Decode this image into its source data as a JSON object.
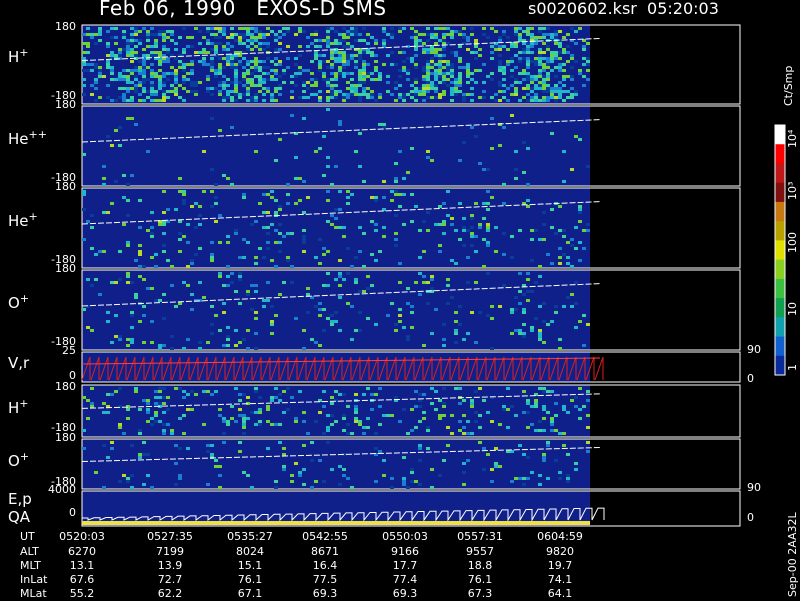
{
  "header": {
    "title": "Feb 06, 1990   EXOS-D SMS",
    "file": "s0020602.ksr  05:20:03"
  },
  "colors": {
    "background": "#000000",
    "panel_bg": "#10208a",
    "trace": "#ffffff",
    "velocity_trace": "#e0201c"
  },
  "panels": [
    {
      "name": "H",
      "sup": "+",
      "top": "180",
      "bottom": "-180"
    },
    {
      "name": "He",
      "sup": "++",
      "top": "180",
      "bottom": "-180"
    },
    {
      "name": "He",
      "sup": "+",
      "top": "180",
      "bottom": "-180"
    },
    {
      "name": "O",
      "sup": "+",
      "top": "180",
      "bottom": "-180"
    },
    {
      "name": "V,r",
      "sup": "",
      "top": "25",
      "bottom": "0",
      "right_top": "90",
      "right_bottom": "0"
    },
    {
      "name": "H",
      "sup": "+",
      "top": "180",
      "bottom": "-180"
    },
    {
      "name": "O",
      "sup": "+",
      "top": "180",
      "bottom": "-180",
      "right_top": "90"
    },
    {
      "name": "E,p",
      "sup": "",
      "top": "4000",
      "bottom": "0",
      "right_bottom": "0",
      "sub": "QA"
    }
  ],
  "colorbar": {
    "unit": "Ct/Smp",
    "ticks": [
      "10⁴",
      "10³",
      "100",
      "10",
      "1"
    ]
  },
  "footer_left": "Sep-00  2AA32L",
  "table": {
    "rows": [
      {
        "label": "UT",
        "values": [
          "0520:03",
          "0527:35",
          "0535:27",
          "0542:55",
          "0550:03",
          "0557:31",
          "0604:59"
        ]
      },
      {
        "label": "ALT",
        "values": [
          "6270",
          "7199",
          "8024",
          "8671",
          "9166",
          "9557",
          "9820"
        ]
      },
      {
        "label": "MLT",
        "values": [
          "13.1",
          "13.9",
          "15.1",
          "16.4",
          "17.7",
          "18.8",
          "19.7"
        ]
      },
      {
        "label": "InLat",
        "values": [
          "67.6",
          "72.7",
          "76.1",
          "77.5",
          "77.4",
          "76.1",
          "74.1"
        ]
      },
      {
        "label": "MLat",
        "values": [
          "55.2",
          "62.2",
          "67.1",
          "69.3",
          "69.3",
          "67.3",
          "64.1"
        ]
      }
    ]
  },
  "chart_data": {
    "type": "heatmap",
    "title": "Feb 06, 1990   EXOS-D SMS",
    "xlabel": "UT",
    "x_ticks": [
      "0520:03",
      "0527:35",
      "0535:27",
      "0542:55",
      "0550:03",
      "0557:31",
      "0604:59"
    ],
    "panels": [
      "H+",
      "He++",
      "He+",
      "O+",
      "V,r",
      "H+",
      "O+",
      "E,p"
    ],
    "ylim_pitch": [
      -180,
      180
    ],
    "colorbar": {
      "label": "Ct/Smp",
      "ticks": [
        "1",
        "10",
        "100",
        "10³",
        "10⁴"
      ],
      "scale": "log"
    }
  }
}
